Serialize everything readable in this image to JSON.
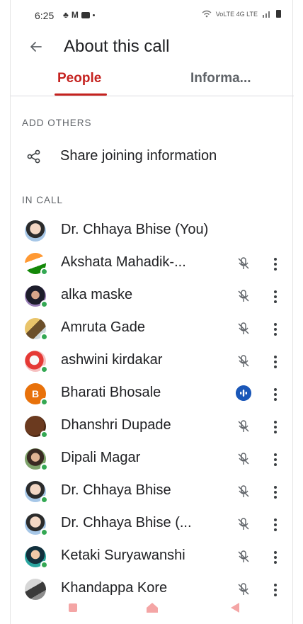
{
  "status_bar": {
    "time": "6:25",
    "left_icons": [
      "app-notification-icon",
      "gmail-icon",
      "youtube-icon",
      "dot-icon"
    ],
    "right_text": "VoLTE 4G LTE",
    "right_icons": [
      "wifi-icon",
      "signal-icon",
      "battery-icon"
    ]
  },
  "header": {
    "back_icon": "arrow-left-icon",
    "title": "About this call"
  },
  "tabs": [
    {
      "label": "People",
      "active": true
    },
    {
      "label": "Informa...",
      "active": false
    }
  ],
  "add_others": {
    "section_label": "ADD OTHERS",
    "share_label": "Share joining information",
    "share_icon": "share-icon"
  },
  "in_call": {
    "section_label": "IN CALL",
    "participants": [
      {
        "name": "Dr. Chhaya Bhise (You)",
        "avatar": "photo",
        "mic": "none"
      },
      {
        "name": "Akshata Mahadik-...",
        "avatar": "photo",
        "mic": "muted"
      },
      {
        "name": "alka maske",
        "avatar": "photo",
        "mic": "muted"
      },
      {
        "name": "Amruta Gade",
        "avatar": "photo",
        "mic": "muted"
      },
      {
        "name": "ashwini kirdakar",
        "avatar": "photo",
        "mic": "muted"
      },
      {
        "name": "Bharati Bhosale",
        "avatar": "B",
        "mic": "speaking"
      },
      {
        "name": "Dhanshri Dupade",
        "avatar": "photo",
        "mic": "muted"
      },
      {
        "name": "Dipali Magar",
        "avatar": "photo",
        "mic": "muted"
      },
      {
        "name": "Dr. Chhaya Bhise",
        "avatar": "photo",
        "mic": "muted"
      },
      {
        "name": "Dr. Chhaya Bhise (...",
        "avatar": "photo",
        "mic": "muted"
      },
      {
        "name": "Ketaki Suryawanshi",
        "avatar": "photo",
        "mic": "muted"
      },
      {
        "name": "Khandappa Kore",
        "avatar": "photo",
        "mic": "muted"
      }
    ]
  },
  "colors": {
    "accent": "#c5221f",
    "online": "#34a853",
    "speaking": "#1a57b8",
    "text": "#202124",
    "secondary": "#5f6368"
  },
  "nav_bar": {
    "icons": [
      "recent-apps-icon",
      "home-icon",
      "back-icon"
    ]
  }
}
